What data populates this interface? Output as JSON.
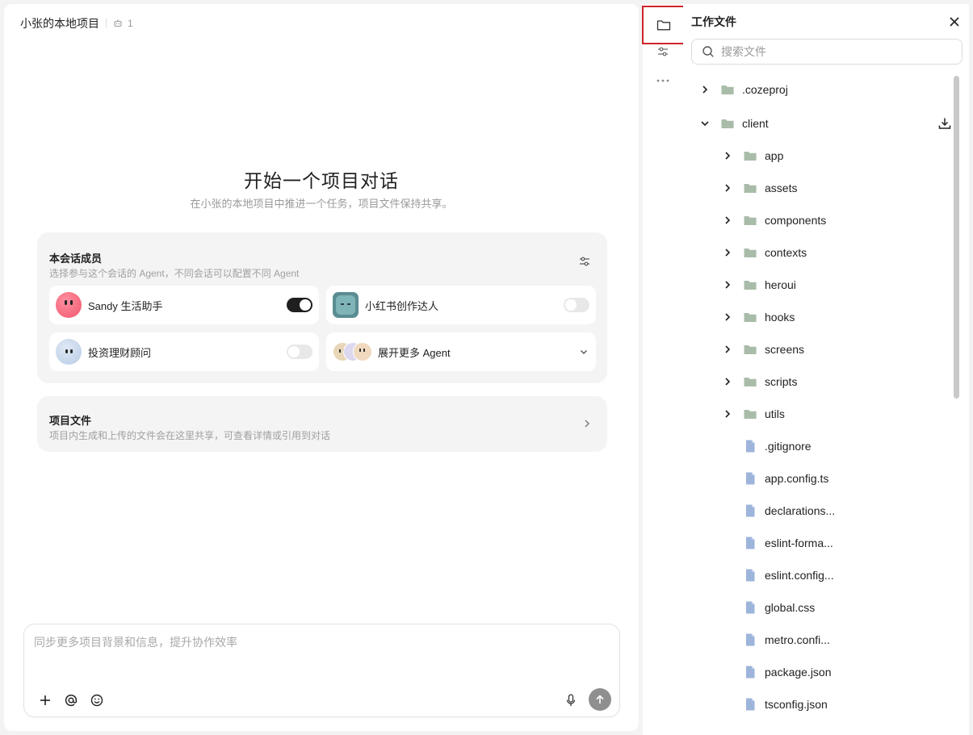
{
  "project": {
    "name": "小张的本地项目",
    "agent_count": "1"
  },
  "hero": {
    "title": "开始一个项目对话",
    "subtitle": "在小张的本地项目中推进一个任务，项目文件保持共享。"
  },
  "members": {
    "title": "本会话成员",
    "subtitle": "选择参与这个会话的 Agent，不同会话可以配置不同 Agent",
    "agents": [
      {
        "name": "Sandy 生活助手",
        "enabled": true
      },
      {
        "name": "小红书创作达人",
        "enabled": false
      },
      {
        "name": "投资理财顾问",
        "enabled": false
      }
    ],
    "more_label": "展开更多 Agent"
  },
  "project_files": {
    "title": "项目文件",
    "subtitle": "项目内生成和上传的文件会在这里共享，可查看详情或引用到对话"
  },
  "composer": {
    "placeholder": "同步更多项目背景和信息，提升协作效率"
  },
  "files_panel": {
    "title": "工作文件",
    "search_placeholder": "搜索文件",
    "tree": [
      {
        "label": ".cozeproj",
        "type": "folder",
        "depth": 0,
        "expanded": false
      },
      {
        "label": "client",
        "type": "folder",
        "depth": 0,
        "expanded": true
      },
      {
        "label": "app",
        "type": "folder",
        "depth": 1,
        "expanded": false
      },
      {
        "label": "assets",
        "type": "folder",
        "depth": 1,
        "expanded": false
      },
      {
        "label": "components",
        "type": "folder",
        "depth": 1,
        "expanded": false
      },
      {
        "label": "contexts",
        "type": "folder",
        "depth": 1,
        "expanded": false
      },
      {
        "label": "heroui",
        "type": "folder",
        "depth": 1,
        "expanded": false
      },
      {
        "label": "hooks",
        "type": "folder",
        "depth": 1,
        "expanded": false
      },
      {
        "label": "screens",
        "type": "folder",
        "depth": 1,
        "expanded": false
      },
      {
        "label": "scripts",
        "type": "folder",
        "depth": 1,
        "expanded": false
      },
      {
        "label": "utils",
        "type": "folder",
        "depth": 1,
        "expanded": false
      },
      {
        "label": ".gitignore",
        "type": "file",
        "depth": 1
      },
      {
        "label": "app.config.ts",
        "type": "file",
        "depth": 1
      },
      {
        "label": "declarations...",
        "type": "file",
        "depth": 1
      },
      {
        "label": "eslint-forma...",
        "type": "file",
        "depth": 1
      },
      {
        "label": "eslint.config...",
        "type": "file",
        "depth": 1
      },
      {
        "label": "global.css",
        "type": "file",
        "depth": 1
      },
      {
        "label": "metro.confi...",
        "type": "file",
        "depth": 1
      },
      {
        "label": "package.json",
        "type": "file",
        "depth": 1
      },
      {
        "label": "tsconfig.json",
        "type": "file",
        "depth": 1
      }
    ]
  },
  "colors": {
    "folder": "#a9bca9",
    "file": "#9db4db",
    "highlight": "#d0232b",
    "toggle_on": "#1f1f1f"
  }
}
